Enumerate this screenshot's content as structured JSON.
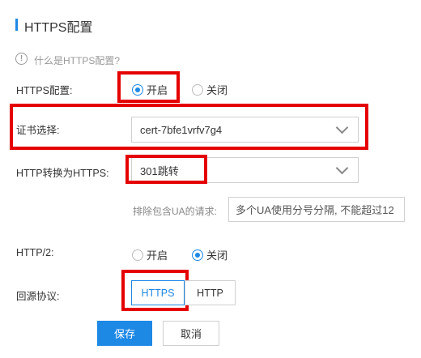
{
  "header": {
    "title": "HTTPS配置"
  },
  "help": {
    "icon": "!",
    "text": "什么是HTTPS配置?"
  },
  "https_config": {
    "label": "HTTPS配置:",
    "on": "开启",
    "off": "关闭",
    "selected": "on"
  },
  "cert": {
    "label": "证书选择:",
    "value": "cert-7bfe1vrfv7g4"
  },
  "redirect": {
    "label": "HTTP转换为HTTPS:",
    "value": "301跳转"
  },
  "exclude_ua": {
    "label": "排除包含UA的请求:",
    "placeholder": "多个UA使用分号分隔, 不能超过12"
  },
  "http2": {
    "label": "HTTP/2:",
    "on": "开启",
    "off": "关闭",
    "selected": "off"
  },
  "origin_protocol": {
    "label": "回源协议:",
    "options": [
      "HTTPS",
      "HTTP"
    ],
    "selected": "HTTPS"
  },
  "actions": {
    "save": "保存",
    "cancel": "取消"
  },
  "colors": {
    "accent": "#1e88e5",
    "highlight": "#e50000"
  }
}
